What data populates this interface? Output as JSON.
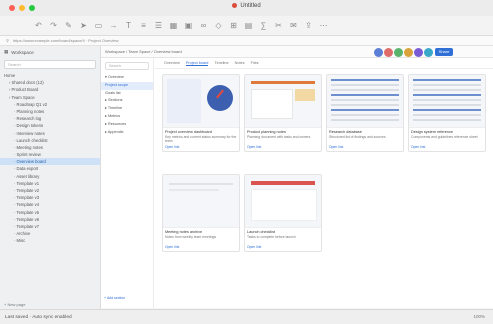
{
  "window": {
    "title": "Untitled",
    "traffic_lights": [
      "#fe5f57",
      "#febc2e",
      "#28c840"
    ]
  },
  "toolbar": {
    "icons": [
      "undo-icon",
      "redo-icon",
      "pen-icon",
      "cursor-icon",
      "rect-icon",
      "arrow-icon",
      "text-icon",
      "align-icon",
      "list-icon",
      "table-icon",
      "image-icon",
      "link-icon",
      "shape-icon",
      "grid-icon",
      "chart-icon",
      "formula-icon",
      "clip-icon",
      "comment-icon",
      "share-icon",
      "more-icon"
    ]
  },
  "address": {
    "text": "https://www.example.com/board/space/4 · Project Overview"
  },
  "sidebar": {
    "header": "Workspace",
    "search_placeholder": "Search",
    "items": [
      {
        "label": "Home",
        "active": false,
        "indent": 0
      },
      {
        "label": "› Shared docs (12)",
        "active": false,
        "indent": 1
      },
      {
        "label": "› Product Board",
        "active": false,
        "indent": 1
      },
      {
        "label": "› Team Space",
        "active": false,
        "indent": 1
      },
      {
        "label": "· Roadmap Q1 v2",
        "active": false,
        "indent": 2
      },
      {
        "label": "· Planning notes",
        "active": false,
        "indent": 2
      },
      {
        "label": "· Research log",
        "active": false,
        "indent": 2
      },
      {
        "label": "· Design tokens",
        "active": false,
        "indent": 2
      },
      {
        "label": "· Interview notes",
        "active": false,
        "indent": 2
      },
      {
        "label": "· Launch checklist",
        "active": false,
        "indent": 2
      },
      {
        "label": "· Meeting notes",
        "active": false,
        "indent": 2
      },
      {
        "label": "· Sprint review",
        "active": false,
        "indent": 2
      },
      {
        "label": "· Overview board",
        "active": true,
        "indent": 2
      },
      {
        "label": "· Data export",
        "active": false,
        "indent": 2
      },
      {
        "label": "· Asset library",
        "active": false,
        "indent": 2
      },
      {
        "label": "· Template v1",
        "active": false,
        "indent": 2
      },
      {
        "label": "· Template v2",
        "active": false,
        "indent": 2
      },
      {
        "label": "· Template v3",
        "active": false,
        "indent": 2
      },
      {
        "label": "· Template v4",
        "active": false,
        "indent": 2
      },
      {
        "label": "· Template v5",
        "active": false,
        "indent": 2
      },
      {
        "label": "· Template v6",
        "active": false,
        "indent": 2
      },
      {
        "label": "· Template v7",
        "active": false,
        "indent": 2
      },
      {
        "label": "· Archive",
        "active": false,
        "indent": 2
      },
      {
        "label": "· Misc",
        "active": false,
        "indent": 2
      }
    ],
    "footer": "+ New page"
  },
  "docstrip": {
    "breadcrumb": "Workspace / Team Space / Overview board",
    "share_label": "Share",
    "avatar_colors": [
      "#5b7fd6",
      "#e06b6b",
      "#59b36b",
      "#d9a23a",
      "#7a5bd6",
      "#3aa8c9"
    ]
  },
  "outline": {
    "search_placeholder": "Search",
    "items": [
      {
        "label": "▾ Overview",
        "sel": false
      },
      {
        "label": "   Project scope",
        "sel": true
      },
      {
        "label": "   Goals list",
        "sel": false
      },
      {
        "label": "▸ Sections",
        "sel": false
      },
      {
        "label": "▸ Timeline",
        "sel": false
      },
      {
        "label": "▸ Metrics",
        "sel": false
      },
      {
        "label": "▸ Resources",
        "sel": false
      },
      {
        "label": "▸ Appendix",
        "sel": false
      }
    ],
    "footer": "+ Add section"
  },
  "main": {
    "tabs": [
      "Overview",
      "Project board",
      "Timeline",
      "Notes",
      "Files"
    ],
    "active_tab": 1,
    "cards": [
      {
        "title": "Project overview dashboard",
        "desc": "Key metrics and current status summary for the team",
        "link": "Open link",
        "thumb": "chart"
      },
      {
        "title": "Product planning notes",
        "desc": "Planning document with tasks and owners",
        "link": "Open link",
        "thumb": "doc"
      },
      {
        "title": "Research database",
        "desc": "Structured list of findings and sources",
        "link": "Open link",
        "thumb": "table"
      },
      {
        "title": "Design system reference",
        "desc": "Components and guidelines reference sheet",
        "link": "Open link",
        "thumb": "table"
      },
      {
        "title": "Meeting notes archive",
        "desc": "Notes from weekly team meetings",
        "link": "Open link",
        "thumb": "blank"
      },
      {
        "title": "Launch checklist",
        "desc": "Tasks to complete before launch",
        "link": "Open link",
        "thumb": "doc2"
      }
    ]
  },
  "statusbar": {
    "text": "Last saved · Auto sync enabled",
    "zoom": "100%"
  }
}
